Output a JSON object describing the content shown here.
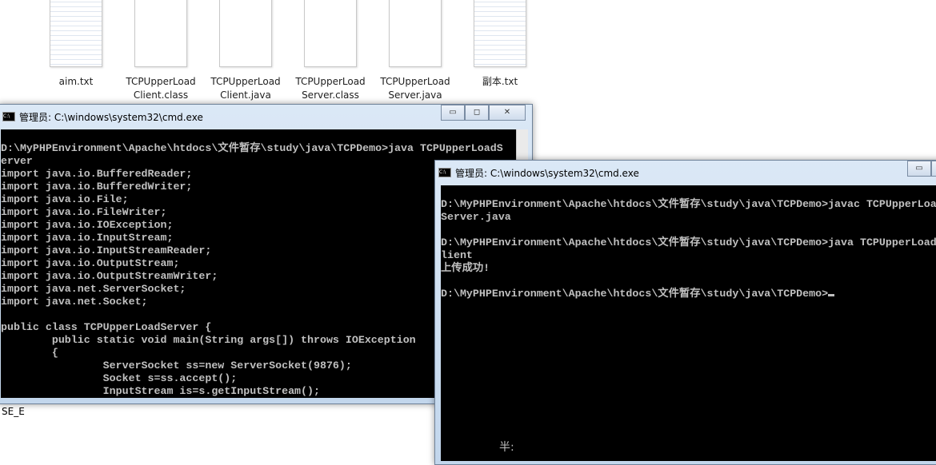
{
  "desktop": {
    "files": [
      {
        "name": "aim.txt",
        "type": "text"
      },
      {
        "name": "TCPUpperLoad\nClient.class",
        "type": "blank"
      },
      {
        "name": "TCPUpperLoad\nClient.java",
        "type": "blank"
      },
      {
        "name": "TCPUpperLoad\nServer.class",
        "type": "blank"
      },
      {
        "name": "TCPUpperLoad\nServer.java",
        "type": "blank"
      },
      {
        "name": "副本.txt",
        "type": "text"
      }
    ],
    "partial_label": "SE_E"
  },
  "window1": {
    "title": "管理员: C:\\windows\\system32\\cmd.exe",
    "lines": [
      "",
      "D:\\MyPHPEnvironment\\Apache\\htdocs\\文件暂存\\study\\java\\TCPDemo>java TCPUpperLoadS",
      "erver",
      "import java.io.BufferedReader;",
      "import java.io.BufferedWriter;",
      "import java.io.File;",
      "import java.io.FileWriter;",
      "import java.io.IOException;",
      "import java.io.InputStream;",
      "import java.io.InputStreamReader;",
      "import java.io.OutputStream;",
      "import java.io.OutputStreamWriter;",
      "import java.net.ServerSocket;",
      "import java.net.Socket;",
      "",
      "public class TCPUpperLoadServer {",
      "        public static void main(String args[]) throws IOException",
      "        {",
      "                ServerSocket ss=new ServerSocket(9876);",
      "                Socket s=ss.accept();",
      "                InputStream is=s.getInputStream();"
    ]
  },
  "window2": {
    "title": "管理员: C:\\windows\\system32\\cmd.exe",
    "lines": [
      "",
      "D:\\MyPHPEnvironment\\Apache\\htdocs\\文件暂存\\study\\java\\TCPDemo>javac TCPUpperLoadC",
      "Server.java",
      "",
      "D:\\MyPHPEnvironment\\Apache\\htdocs\\文件暂存\\study\\java\\TCPDemo>java TCPUpperLoadC",
      "lient",
      "上传成功!",
      "",
      "D:\\MyPHPEnvironment\\Apache\\htdocs\\文件暂存\\study\\java\\TCPDemo>"
    ],
    "ime": "半:"
  },
  "buttons": {
    "minimize": "▭",
    "maximize": "◻",
    "close": "✕"
  }
}
